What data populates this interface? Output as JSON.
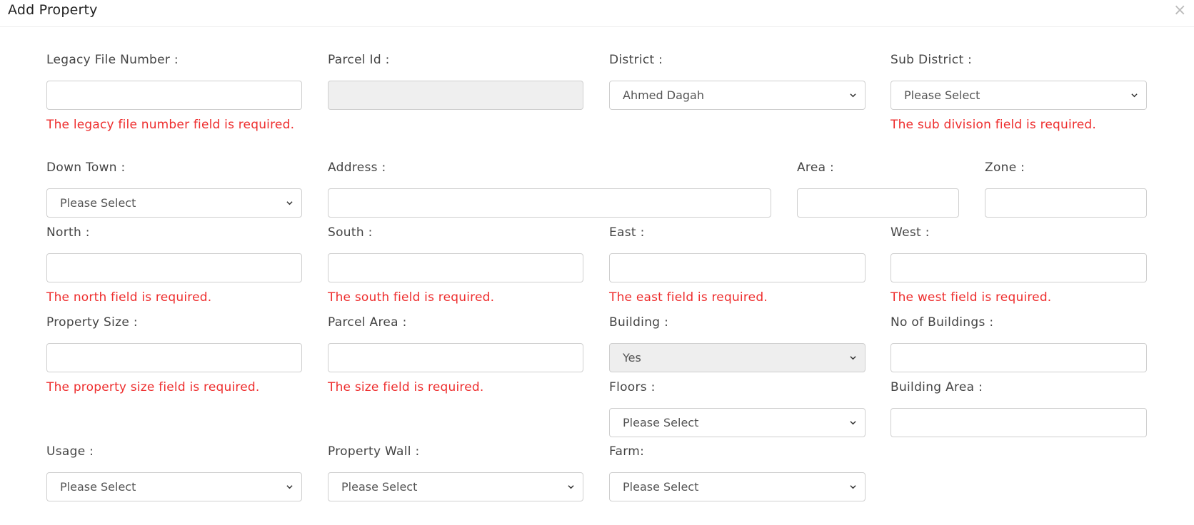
{
  "dialog": {
    "title": "Add Property",
    "close_label": "×"
  },
  "form": {
    "legacy_file_number": {
      "label": "Legacy File Number :",
      "value": "",
      "error": "The legacy file number field is required."
    },
    "parcel_id": {
      "label": "Parcel Id :",
      "value": ""
    },
    "district": {
      "label": "District :",
      "selected": "Ahmed Dagah"
    },
    "sub_district": {
      "label": "Sub District :",
      "selected": "Please Select",
      "error": "The sub division field is required."
    },
    "down_town": {
      "label": "Down Town :",
      "selected": "Please Select"
    },
    "address": {
      "label": "Address :",
      "value": ""
    },
    "area": {
      "label": "Area :",
      "value": ""
    },
    "zone": {
      "label": "Zone :",
      "value": ""
    },
    "north": {
      "label": "North :",
      "value": "",
      "error": "The north field is required."
    },
    "south": {
      "label": "South :",
      "value": "",
      "error": "The south field is required."
    },
    "east": {
      "label": "East :",
      "value": "",
      "error": "The east field is required."
    },
    "west": {
      "label": "West :",
      "value": "",
      "error": "The west field is required."
    },
    "property_size": {
      "label": "Property Size :",
      "value": "",
      "error": "The property size field is required."
    },
    "parcel_area": {
      "label": "Parcel Area :",
      "value": "",
      "error": "The size field is required."
    },
    "building": {
      "label": "Building :",
      "selected": "Yes"
    },
    "no_of_buildings": {
      "label": "No of Buildings :",
      "value": ""
    },
    "floors": {
      "label": "Floors :",
      "selected": "Please Select"
    },
    "building_area": {
      "label": "Building Area :",
      "value": ""
    },
    "usage": {
      "label": "Usage :",
      "selected": "Please Select"
    },
    "property_wall": {
      "label": "Property Wall :",
      "selected": "Please Select"
    },
    "farm": {
      "label": "Farm:",
      "selected": "Please Select"
    }
  },
  "colors": {
    "error": "#ee2d2d",
    "border": "#cfcfcf",
    "disabled_bg": "#efefef"
  },
  "icons": {
    "select_arrow": "chevron-down-icon",
    "close": "close-icon"
  }
}
